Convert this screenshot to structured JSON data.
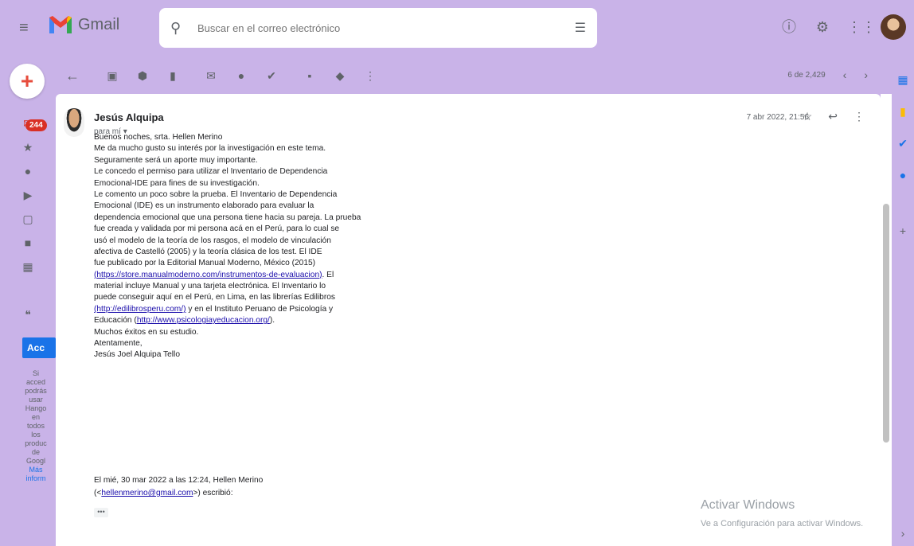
{
  "app": {
    "name": "Gmail"
  },
  "search": {
    "placeholder": "Buscar en el correo electrónico"
  },
  "left_rail": {
    "inbox_count": "244",
    "hangouts_button": "Acc",
    "hangouts_text": [
      "Si",
      "acced",
      "podrás",
      "usar",
      "Hango",
      "en",
      "todos",
      "los",
      "produc",
      "de",
      "Googl"
    ],
    "hangouts_link": [
      "Más",
      "inform"
    ]
  },
  "toolbar": {
    "pager": "6 de 2,429"
  },
  "message": {
    "sender": "Jesús Alquipa",
    "to": "para mí",
    "date": "7 abr 2022, 21:56",
    "body": [
      "Buenos noches, srta. Hellen Merino",
      "Me da mucho gusto su interés por la investigación en este tema.",
      "Seguramente será un  aporte muy importante.",
      "Le concedo el permiso para utilizar el Inventario de Dependencia",
      "Emocional-IDE para fines de su investigación.",
      "Le comento un poco sobre la prueba. El Inventario de Dependencia",
      "Emocional (IDE) es un instrumento elaborado para evaluar la",
      "dependencia emocional que una persona tiene hacia su pareja. La prueba",
      "fue creada y validada por mi persona acá en el Perú, para lo cual se",
      "usó el modelo de la teoría de los rasgos, el modelo de vinculación",
      "afectiva de Castelló (2005) y la teoría clásica de los test. El IDE",
      "fue publicado por la Editorial Manual Moderno, México (2015)"
    ],
    "link_line_1": {
      "link": "(https://store.manualmoderno.com/instrumentos-de-evaluacion)",
      "after": ". El"
    },
    "body_2": [
      "material incluye Manual y una tarjeta electrónica. El Inventario lo",
      "puede conseguir aquí en el Perú, en Lima, en las librerías Edilibros"
    ],
    "link_line_2": {
      "link": "(http://edilibrosperu.com/)",
      "after": " y en el Instituto Peruano de Psicología y"
    },
    "link_line_3": {
      "before": "Educación (",
      "link": "http://www.psicologiayeducacion.org/",
      "after": ")."
    },
    "body_3": [
      "Muchos éxitos en su estudio.",
      "Atentamente,",
      "Jesús Joel Alquipa Tello"
    ],
    "quote_header": "El mié, 30 mar 2022 a las 12:24, Hellen Merino",
    "quote_email_before": "(<",
    "quote_email": "hellenmerino@gmail.com",
    "quote_email_after": ">) escribió:",
    "dots": "•••"
  },
  "watermark": {
    "line1": "Activar Windows",
    "line2": "Ve a Configuración para activar Windows."
  }
}
